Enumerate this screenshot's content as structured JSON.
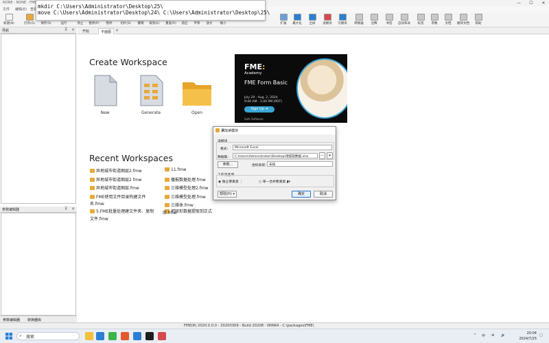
{
  "window": {
    "title": "NONE - NONE - FME",
    "controls": [
      "—",
      "☐",
      "✕"
    ]
  },
  "menu": [
    "文件",
    "编辑(E)",
    "查看"
  ],
  "cmd": {
    "line1": "mkdir C:\\Users\\Administrator\\Desktop\\25\\",
    "line2": "move C:\\Users\\Administrator\\Desktop\\24\\ C:\\Users\\Administrator\\Desktop\\25\\"
  },
  "toolbar": {
    "items": [
      {
        "label": "新建(N)",
        "icon": "new-icon",
        "color": "#f3f3f3"
      },
      {
        "label": "打开(O)",
        "icon": "open-icon",
        "color": "#e7a93b"
      },
      {
        "label": "保存(S)",
        "icon": "save-icon",
        "color": "#c8c8c8"
      },
      {
        "label": "运行",
        "icon": "run-icon",
        "color": "#3bb54a"
      },
      {
        "label": "停止",
        "icon": "stop-icon",
        "color": "#c8c8c8"
      },
      {
        "label": "暂停(P)",
        "icon": "pause-icon",
        "color": "#c8c8c8"
      },
      {
        "label": "暂停",
        "icon": "pause2-icon",
        "color": "#c8c8c8"
      },
      {
        "label": "切片(S)",
        "icon": "slice-icon",
        "color": "#c8c8c8"
      },
      {
        "label": "撤销",
        "icon": "undo-icon",
        "color": "#c8c8c8"
      },
      {
        "label": "取消(E)",
        "icon": "cancel-icon",
        "color": "#c8c8c8"
      },
      {
        "label": "重复(R)",
        "icon": "redo-icon",
        "color": "#c8c8c8"
      },
      {
        "label": "适应",
        "icon": "fit-icon",
        "color": "#c8c8c8"
      },
      {
        "label": "平移",
        "icon": "pan-icon",
        "color": "#c8c8c8"
      },
      {
        "label": "放大",
        "icon": "zoom-in-icon",
        "color": "#c8c8c8"
      },
      {
        "label": "缩小",
        "icon": "zoom-out-icon",
        "color": "#c8c8c8"
      },
      {
        "label": "扩展",
        "icon": "expand-icon",
        "color": "#6aa0d8"
      },
      {
        "label": "最大化",
        "icon": "maximize-icon",
        "color": "#2a7fd4"
      },
      {
        "label": "全屏",
        "icon": "fullscreen-icon",
        "color": "#2a7fd4"
      },
      {
        "label": "读模块",
        "icon": "reader-icon",
        "color": "#d84a4a"
      },
      {
        "label": "写模块",
        "icon": "writer-icon",
        "color": "#2a7fd4"
      },
      {
        "label": "转换器",
        "icon": "transformer-icon",
        "color": "#c8c8c8"
      },
      {
        "label": "注释",
        "icon": "annotation-icon",
        "color": "#c8c8c8"
      },
      {
        "label": "书签",
        "icon": "bookmark-icon",
        "color": "#c8c8c8"
      },
      {
        "label": "自动布局",
        "icon": "autolayout-icon",
        "color": "#c8c8c8"
      },
      {
        "label": "标签",
        "icon": "tag-icon",
        "color": "#c8c8c8"
      },
      {
        "label": "参数",
        "icon": "parameter-icon",
        "color": "#c8c8c8"
      },
      {
        "label": "文档",
        "icon": "doc-icon",
        "color": "#c8c8c8"
      },
      {
        "label": "翻译文档",
        "icon": "translate-icon",
        "color": "#c8c8c8"
      },
      {
        "label": "帮助",
        "icon": "help-icon",
        "color": "#c8c8c8"
      }
    ]
  },
  "panels": {
    "navigator": "导航",
    "parameter_editor": "参数编辑器",
    "bottom_tabs": [
      "参数编辑器",
      "转换器库"
    ]
  },
  "tabs": [
    "开始",
    "平面图"
  ],
  "start": {
    "create_title": "Create Workspace",
    "create_items": [
      {
        "label": "New",
        "icon": "new-document-icon"
      },
      {
        "label": "Generate",
        "icon": "generate-icon"
      },
      {
        "label": "Open",
        "icon": "folder-icon"
      }
    ],
    "recent_title": "Recent Workspaces",
    "recent_left": [
      "异地城市街道图层2.fmw",
      "异地城市街道图层2 fmw",
      "异地城市街道图层.fmw",
      "FME使用文件目录构建文件",
      "名.fmw",
      "5.FME批量处理建文件夹、复制",
      "文件.fmw"
    ],
    "recent_right": [
      "11.fmw",
      "播报数据处理.fmw",
      "三维模型处理2.fmw",
      "三维模型处理.fmw",
      "三维体.fmw",
      "把矩形数据提取到正式",
      "库.fmw"
    ]
  },
  "banner": {
    "brand": "FME",
    "sub": "Academy",
    "course": "FME Form Basic",
    "date": "July 29 - Aug. 2, 2024",
    "time": "9:00 AM - 1:00 PM (PDT)",
    "cta": "Sign Up",
    "company": "Safe Software",
    "accent": "#3aa6d6"
  },
  "dialog": {
    "title": "添加读模块",
    "section_reader": "读模块",
    "format_label": "格式:",
    "format_value": "Microsoft Excel",
    "dataset_label": "数据集:",
    "dataset_value": "C:\\Users\\Administrator\\Desktop\\待提取数据.xlsx",
    "params_button": "参数...",
    "coord_label": "坐标系统:",
    "coord_value": "未知",
    "workflow_label": "工作流选项",
    "opt_single": "独立要素类",
    "opt_merge": "单一合并要素类",
    "help_button": "帮助(H)",
    "ok_button": "确定",
    "cancel_button": "取消"
  },
  "statusbar": "FME(R) 2020.0.0.0 - 20200309 - Build 20208 - WIN64 - C:\\packages\\FME\\",
  "taskbar": {
    "search": "搜索",
    "apps": [
      "#f0c13b",
      "#2a7fd4",
      "#3bb54a",
      "#e05a2a",
      "#2a7fd4",
      "#1e1e1e",
      "#d84a4a"
    ],
    "tray": [
      "^",
      "中",
      "⊕",
      "🔊"
    ],
    "time": "20:04",
    "date": "2024/7/25"
  }
}
